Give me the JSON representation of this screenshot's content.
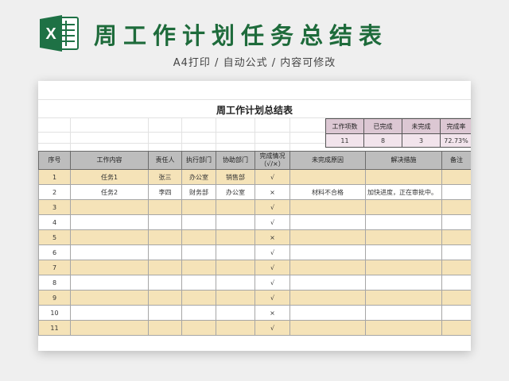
{
  "header": {
    "title": "周工作计划任务总结表",
    "subtitle": "A4打印 / 自动公式 / 内容可修改",
    "logo_letter": "X",
    "logo_color": "#1e7145"
  },
  "sheet": {
    "title": "周工作计划总结表",
    "summary": {
      "headers": [
        "工作项数",
        "已完成",
        "未完成",
        "完成率"
      ],
      "values": [
        "11",
        "8",
        "3",
        "72.73%"
      ]
    },
    "table": {
      "headers": [
        "序号",
        "工作内容",
        "责任人",
        "执行部门",
        "协助部门",
        "完成情况\n（√/×）",
        "未完成原因",
        "解决措施",
        "备注"
      ],
      "rows": [
        [
          "1",
          "任务1",
          "张三",
          "办公室",
          "销售部",
          "√",
          "",
          "",
          ""
        ],
        [
          "2",
          "任务2",
          "李四",
          "财务部",
          "办公室",
          "×",
          "材料不合格",
          "加快进度，正在审批中。",
          ""
        ],
        [
          "3",
          "",
          "",
          "",
          "",
          "√",
          "",
          "",
          ""
        ],
        [
          "4",
          "",
          "",
          "",
          "",
          "√",
          "",
          "",
          ""
        ],
        [
          "5",
          "",
          "",
          "",
          "",
          "×",
          "",
          "",
          ""
        ],
        [
          "6",
          "",
          "",
          "",
          "",
          "√",
          "",
          "",
          ""
        ],
        [
          "7",
          "",
          "",
          "",
          "",
          "√",
          "",
          "",
          ""
        ],
        [
          "8",
          "",
          "",
          "",
          "",
          "√",
          "",
          "",
          ""
        ],
        [
          "9",
          "",
          "",
          "",
          "",
          "√",
          "",
          "",
          ""
        ],
        [
          "10",
          "",
          "",
          "",
          "",
          "×",
          "",
          "",
          ""
        ],
        [
          "11",
          "",
          "",
          "",
          "",
          "√",
          "",
          "",
          ""
        ]
      ]
    }
  }
}
